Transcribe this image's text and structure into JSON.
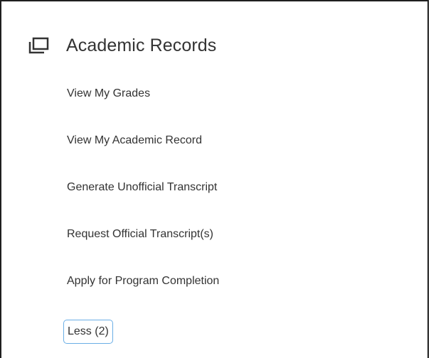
{
  "section": {
    "title": "Academic Records",
    "icon": "copy-windows-icon"
  },
  "menu": {
    "items": [
      {
        "label": "View My Grades"
      },
      {
        "label": "View My Academic Record"
      },
      {
        "label": "Generate Unofficial Transcript"
      },
      {
        "label": "Request Official Transcript(s)"
      },
      {
        "label": "Apply for Program Completion"
      }
    ],
    "less_label": "Less (2)"
  },
  "colors": {
    "text": "#333333",
    "focus_outline": "#6aaee6",
    "border": "#1f1f1f"
  }
}
